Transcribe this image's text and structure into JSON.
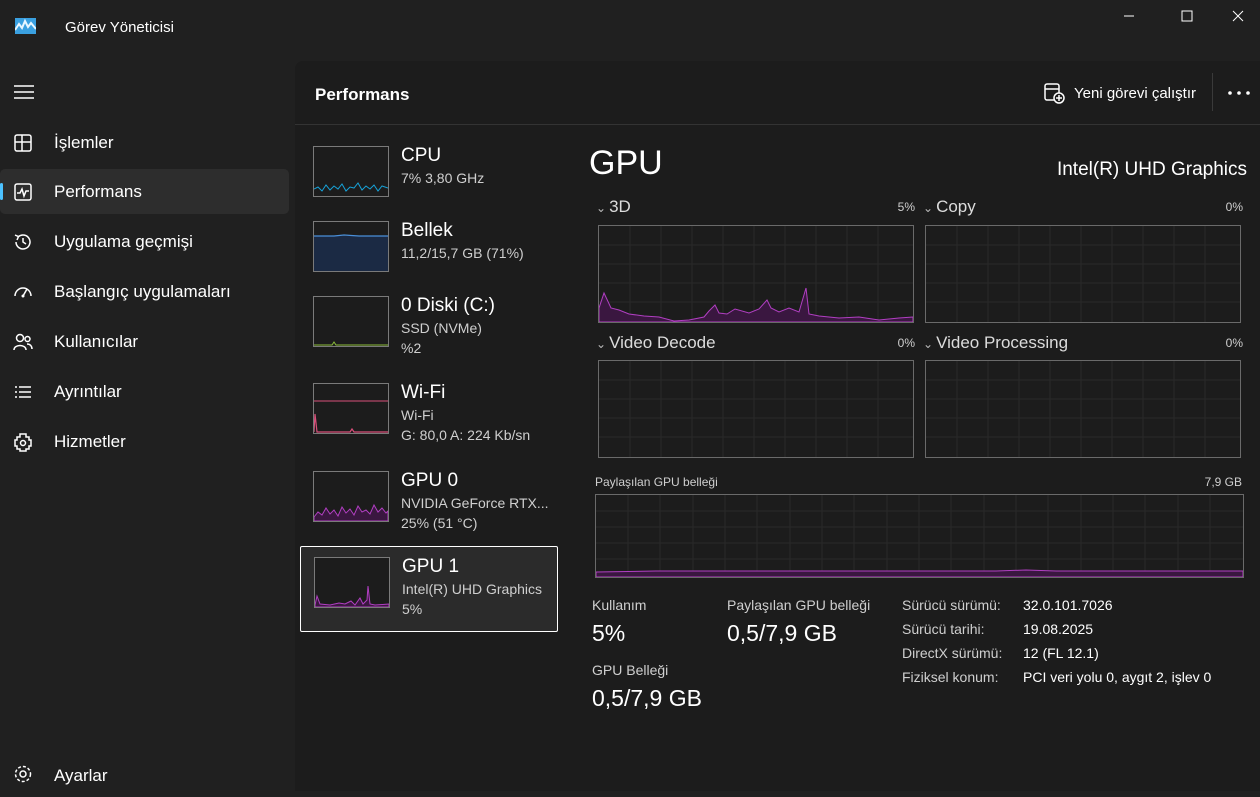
{
  "app": {
    "title": "Görev Yöneticisi"
  },
  "nav": {
    "items": [
      {
        "label": "İşlemler",
        "icon": "processes-icon"
      },
      {
        "label": "Performans",
        "icon": "performance-icon",
        "active": true
      },
      {
        "label": "Uygulama geçmişi",
        "icon": "history-icon"
      },
      {
        "label": "Başlangıç uygulamaları",
        "icon": "startup-icon"
      },
      {
        "label": "Kullanıcılar",
        "icon": "users-icon"
      },
      {
        "label": "Ayrıntılar",
        "icon": "details-icon"
      },
      {
        "label": "Hizmetler",
        "icon": "services-icon"
      }
    ],
    "settings": "Ayarlar"
  },
  "header": {
    "title": "Performans",
    "run_task": "Yeni görevi çalıştır"
  },
  "devices": [
    {
      "name": "CPU",
      "sub1": "7%  3,80 GHz",
      "sub2": "",
      "color": "#17a2d8"
    },
    {
      "name": "Bellek",
      "sub1": "11,2/15,7 GB (71%)",
      "sub2": "",
      "color": "#4a8fd9"
    },
    {
      "name": "0 Diski (C:)",
      "sub1": "SSD (NVMe)",
      "sub2": "%2",
      "color": "#8bbd3a"
    },
    {
      "name": "Wi-Fi",
      "sub1": "Wi-Fi",
      "sub2": "G: 80,0  A: 224 Kb/sn",
      "color": "#d94f7a"
    },
    {
      "name": "GPU 0",
      "sub1": "NVIDIA GeForce RTX...",
      "sub2": "25%  (51 °C)",
      "color": "#b13fc2"
    },
    {
      "name": "GPU 1",
      "sub1": "Intel(R) UHD Graphics",
      "sub2": "5%",
      "color": "#b13fc2",
      "selected": true
    }
  ],
  "gpu": {
    "title": "GPU",
    "model": "Intel(R) UHD Graphics",
    "engines": [
      {
        "name": "3D",
        "percent": "5%"
      },
      {
        "name": "Copy",
        "percent": "0%"
      },
      {
        "name": "Video Decode",
        "percent": "0%"
      },
      {
        "name": "Video Processing",
        "percent": "0%"
      }
    ],
    "shared_memory": {
      "label": "Paylaşılan GPU belleği",
      "max": "7,9 GB"
    },
    "stats": {
      "utilization_label": "Kullanım",
      "utilization_value": "5%",
      "shared_label": "Paylaşılan GPU belleği",
      "shared_value": "0,5/7,9 GB",
      "memory_label": "GPU Belleği",
      "memory_value": "0,5/7,9 GB"
    },
    "info": [
      {
        "label": "Sürücü sürümü:",
        "value": "32.0.101.7026"
      },
      {
        "label": "Sürücü tarihi:",
        "value": "19.08.2025"
      },
      {
        "label": "DirectX sürümü:",
        "value": "12 (FL 12.1)"
      },
      {
        "label": "Fiziksel konum:",
        "value": "PCI veri yolu 0, aygıt 2, işlev 0"
      }
    ]
  },
  "colors": {
    "accent": "#4cc2ff",
    "gpu": "#b13fc2",
    "background": "#202020",
    "panel": "#1c1c1c"
  }
}
